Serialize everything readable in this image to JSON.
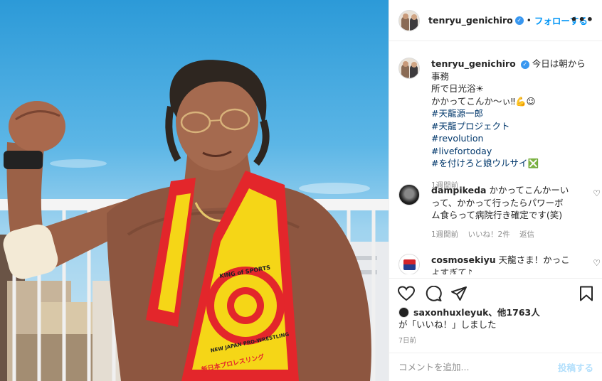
{
  "post": {
    "username": "tenryu_genichiro",
    "verified_icon": "verified-badge-icon",
    "separator": "•",
    "follow_label": "フォローする",
    "more_label": "•••"
  },
  "caption": {
    "username": "tenryu_genichiro",
    "text_line1": "今日は朝から事務",
    "text_line2": "所で日光浴☀",
    "text_line3": "かかってこんか〜ぃ‼💪😉",
    "hashtags": [
      "#天龍源一郎",
      "#天龍プロジェクト",
      "#revolution",
      "#livefortoday",
      "#を付けろと娘ウルサイ❎"
    ],
    "time": "1週間前"
  },
  "comments": [
    {
      "username": "dampikeda",
      "text_line1": "かかってこんかーい",
      "text_line2": "って、かかって行ったらパワーボ",
      "text_line3": "ム食らって病院行き確定です(笑)",
      "time": "1週間前",
      "likes": "いいね！2件",
      "reply": "返信"
    },
    {
      "username": "cosmosekiyu",
      "text_line1": "天龍さま！かっこ",
      "text_line2": "よすぎて♪"
    }
  ],
  "likes": {
    "first_user": "saxonhuxleyuk",
    "others": "、他1763人",
    "suffix": "が「いいね！」しました"
  },
  "date": "7日前",
  "comment_box": {
    "placeholder": "コメントを追加...",
    "post_label": "投稿する"
  },
  "photo_text": {
    "towel_logo": "KING of SPORTS",
    "towel_ring": "NEW JAPAN PRO-WRESTLING",
    "towel_bottom": "新日本プロレスリング"
  },
  "colors": {
    "follow_blue": "#0095f6",
    "hashtag": "#00376b",
    "muted": "#8e8e8e",
    "towel_red": "#e3262b",
    "towel_yellow": "#f5d617"
  }
}
